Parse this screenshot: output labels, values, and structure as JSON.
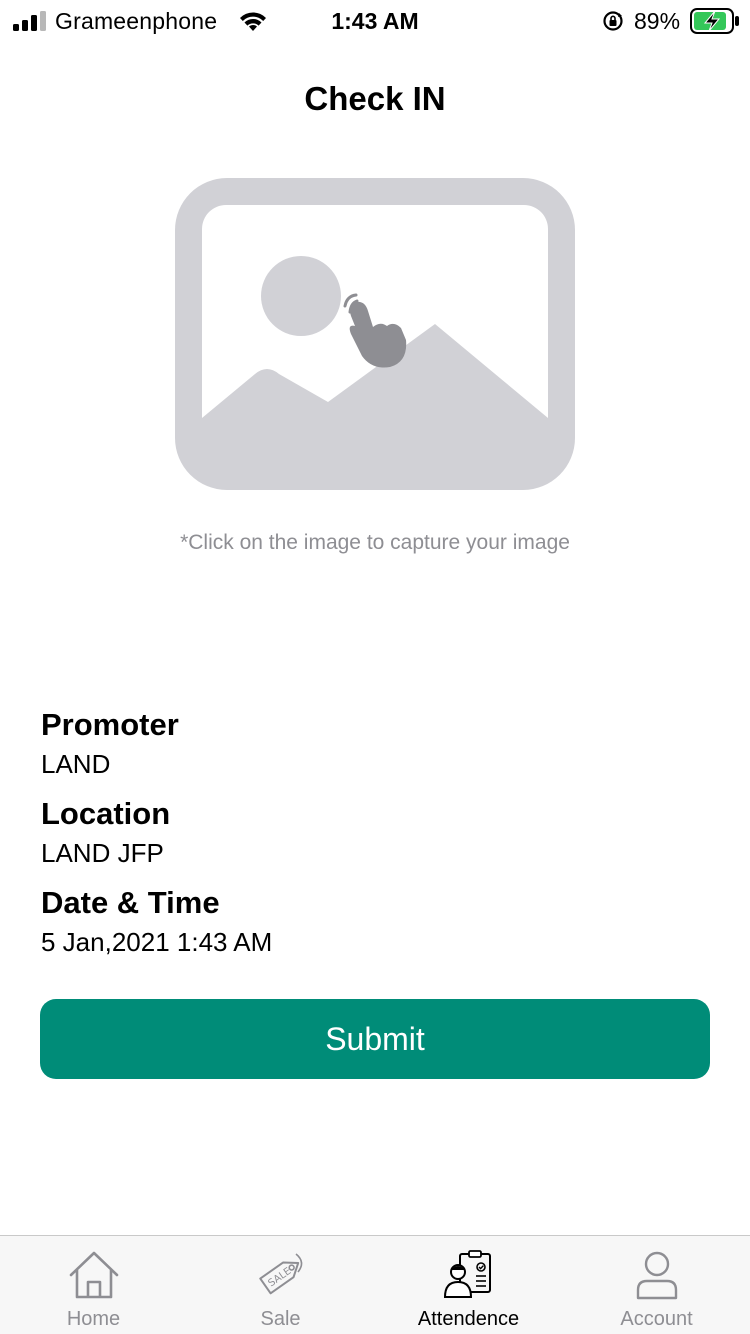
{
  "status_bar": {
    "carrier": "Grameenphone",
    "time": "1:43 AM",
    "battery_percent": "89%",
    "battery_level": 0.89,
    "icons": [
      "signal-icon",
      "wifi-icon",
      "rotation-lock-icon",
      "battery-charging-icon"
    ]
  },
  "page": {
    "title": "Check IN"
  },
  "capture": {
    "icon": "image-tap-icon",
    "hint": "*Click on the image to capture your image"
  },
  "info": {
    "promoter_label": "Promoter",
    "promoter_value": "LAND",
    "location_label": "Location",
    "location_value": "LAND JFP",
    "datetime_label": "Date & Time",
    "datetime_value": "5 Jan,2021 1:43 AM"
  },
  "submit_label": "Submit",
  "colors": {
    "primary": "#008c78",
    "placeholder": "#d1d1d6",
    "hint": "#8e8e93",
    "battery_green": "#34c759"
  },
  "tabs": [
    {
      "label": "Home",
      "icon": "home-icon",
      "active": false
    },
    {
      "label": "Sale",
      "icon": "sale-tag-icon",
      "active": false
    },
    {
      "label": "Attendence",
      "icon": "attendance-icon",
      "active": true
    },
    {
      "label": "Account",
      "icon": "account-icon",
      "active": false
    }
  ]
}
